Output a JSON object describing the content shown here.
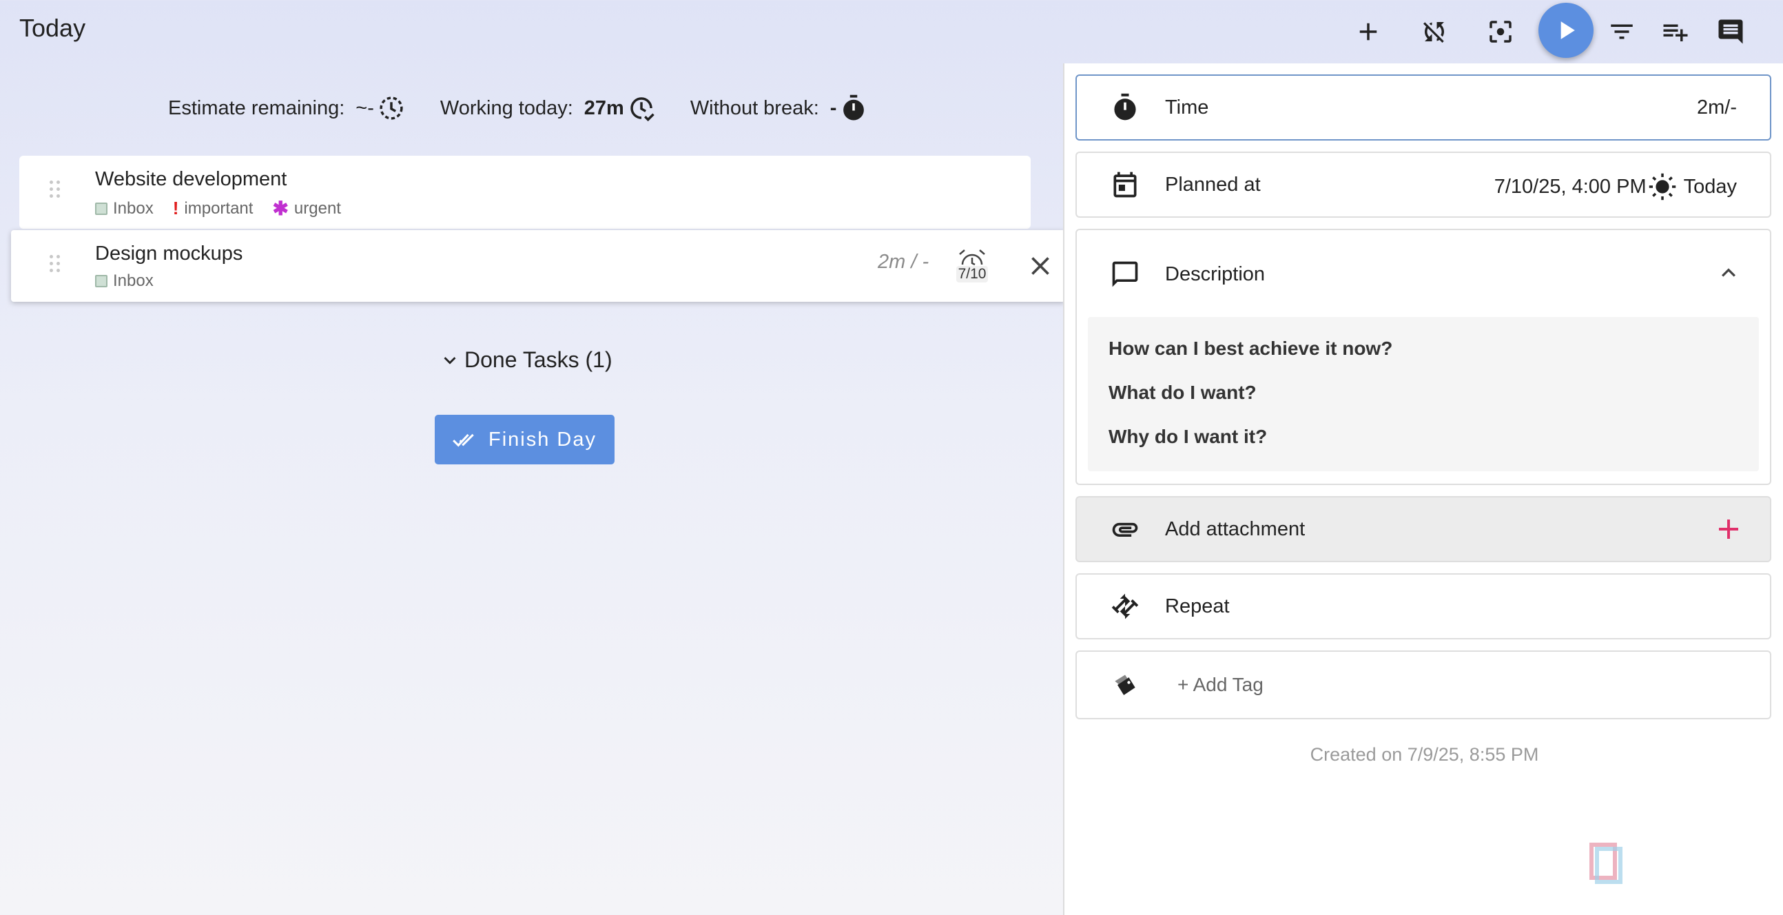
{
  "header": {
    "title": "Today",
    "buttons": [
      "add-task",
      "sync",
      "focus-mode",
      "play",
      "filter",
      "add-to-list",
      "notes"
    ]
  },
  "stats": {
    "estimate_label": "Estimate remaining:",
    "estimate_value": "~-",
    "working_label": "Working today:",
    "working_value": "27m",
    "break_label": "Without break:",
    "break_value": "-"
  },
  "tasks": [
    {
      "title": "Website development",
      "tags": [
        {
          "label": "Inbox",
          "icon": "inbox-icon"
        },
        {
          "label": "important",
          "icon": "exclamation-icon",
          "color": "#e01b1b"
        },
        {
          "label": "urgent",
          "icon": "asterisk-icon",
          "color": "#c030d0"
        }
      ]
    },
    {
      "title": "Design mockups",
      "tags": [
        {
          "label": "Inbox",
          "icon": "inbox-icon"
        }
      ],
      "time": "2m / -",
      "reminder": "7/10"
    }
  ],
  "done_tasks": "Done Tasks (1)",
  "finish_day": "Finish Day",
  "panel": {
    "time_label": "Time",
    "time_value": "2m/-",
    "planned_label": "Planned at",
    "planned_value": "7/10/25, 4:00 PM",
    "planned_day": "Today",
    "description_label": "Description",
    "description_lines": [
      "How can I best achieve it now?",
      "What do I want?",
      "Why do I want it?"
    ],
    "attachment_label": "Add attachment",
    "repeat_label": "Repeat",
    "add_tag": "+ Add Tag",
    "created": "Created on 7/9/25, 8:55 PM"
  },
  "colors": {
    "accent": "#5c8fe0",
    "important": "#e01b1b",
    "urgent": "#c030d0",
    "add_pink": "#e0306a"
  }
}
